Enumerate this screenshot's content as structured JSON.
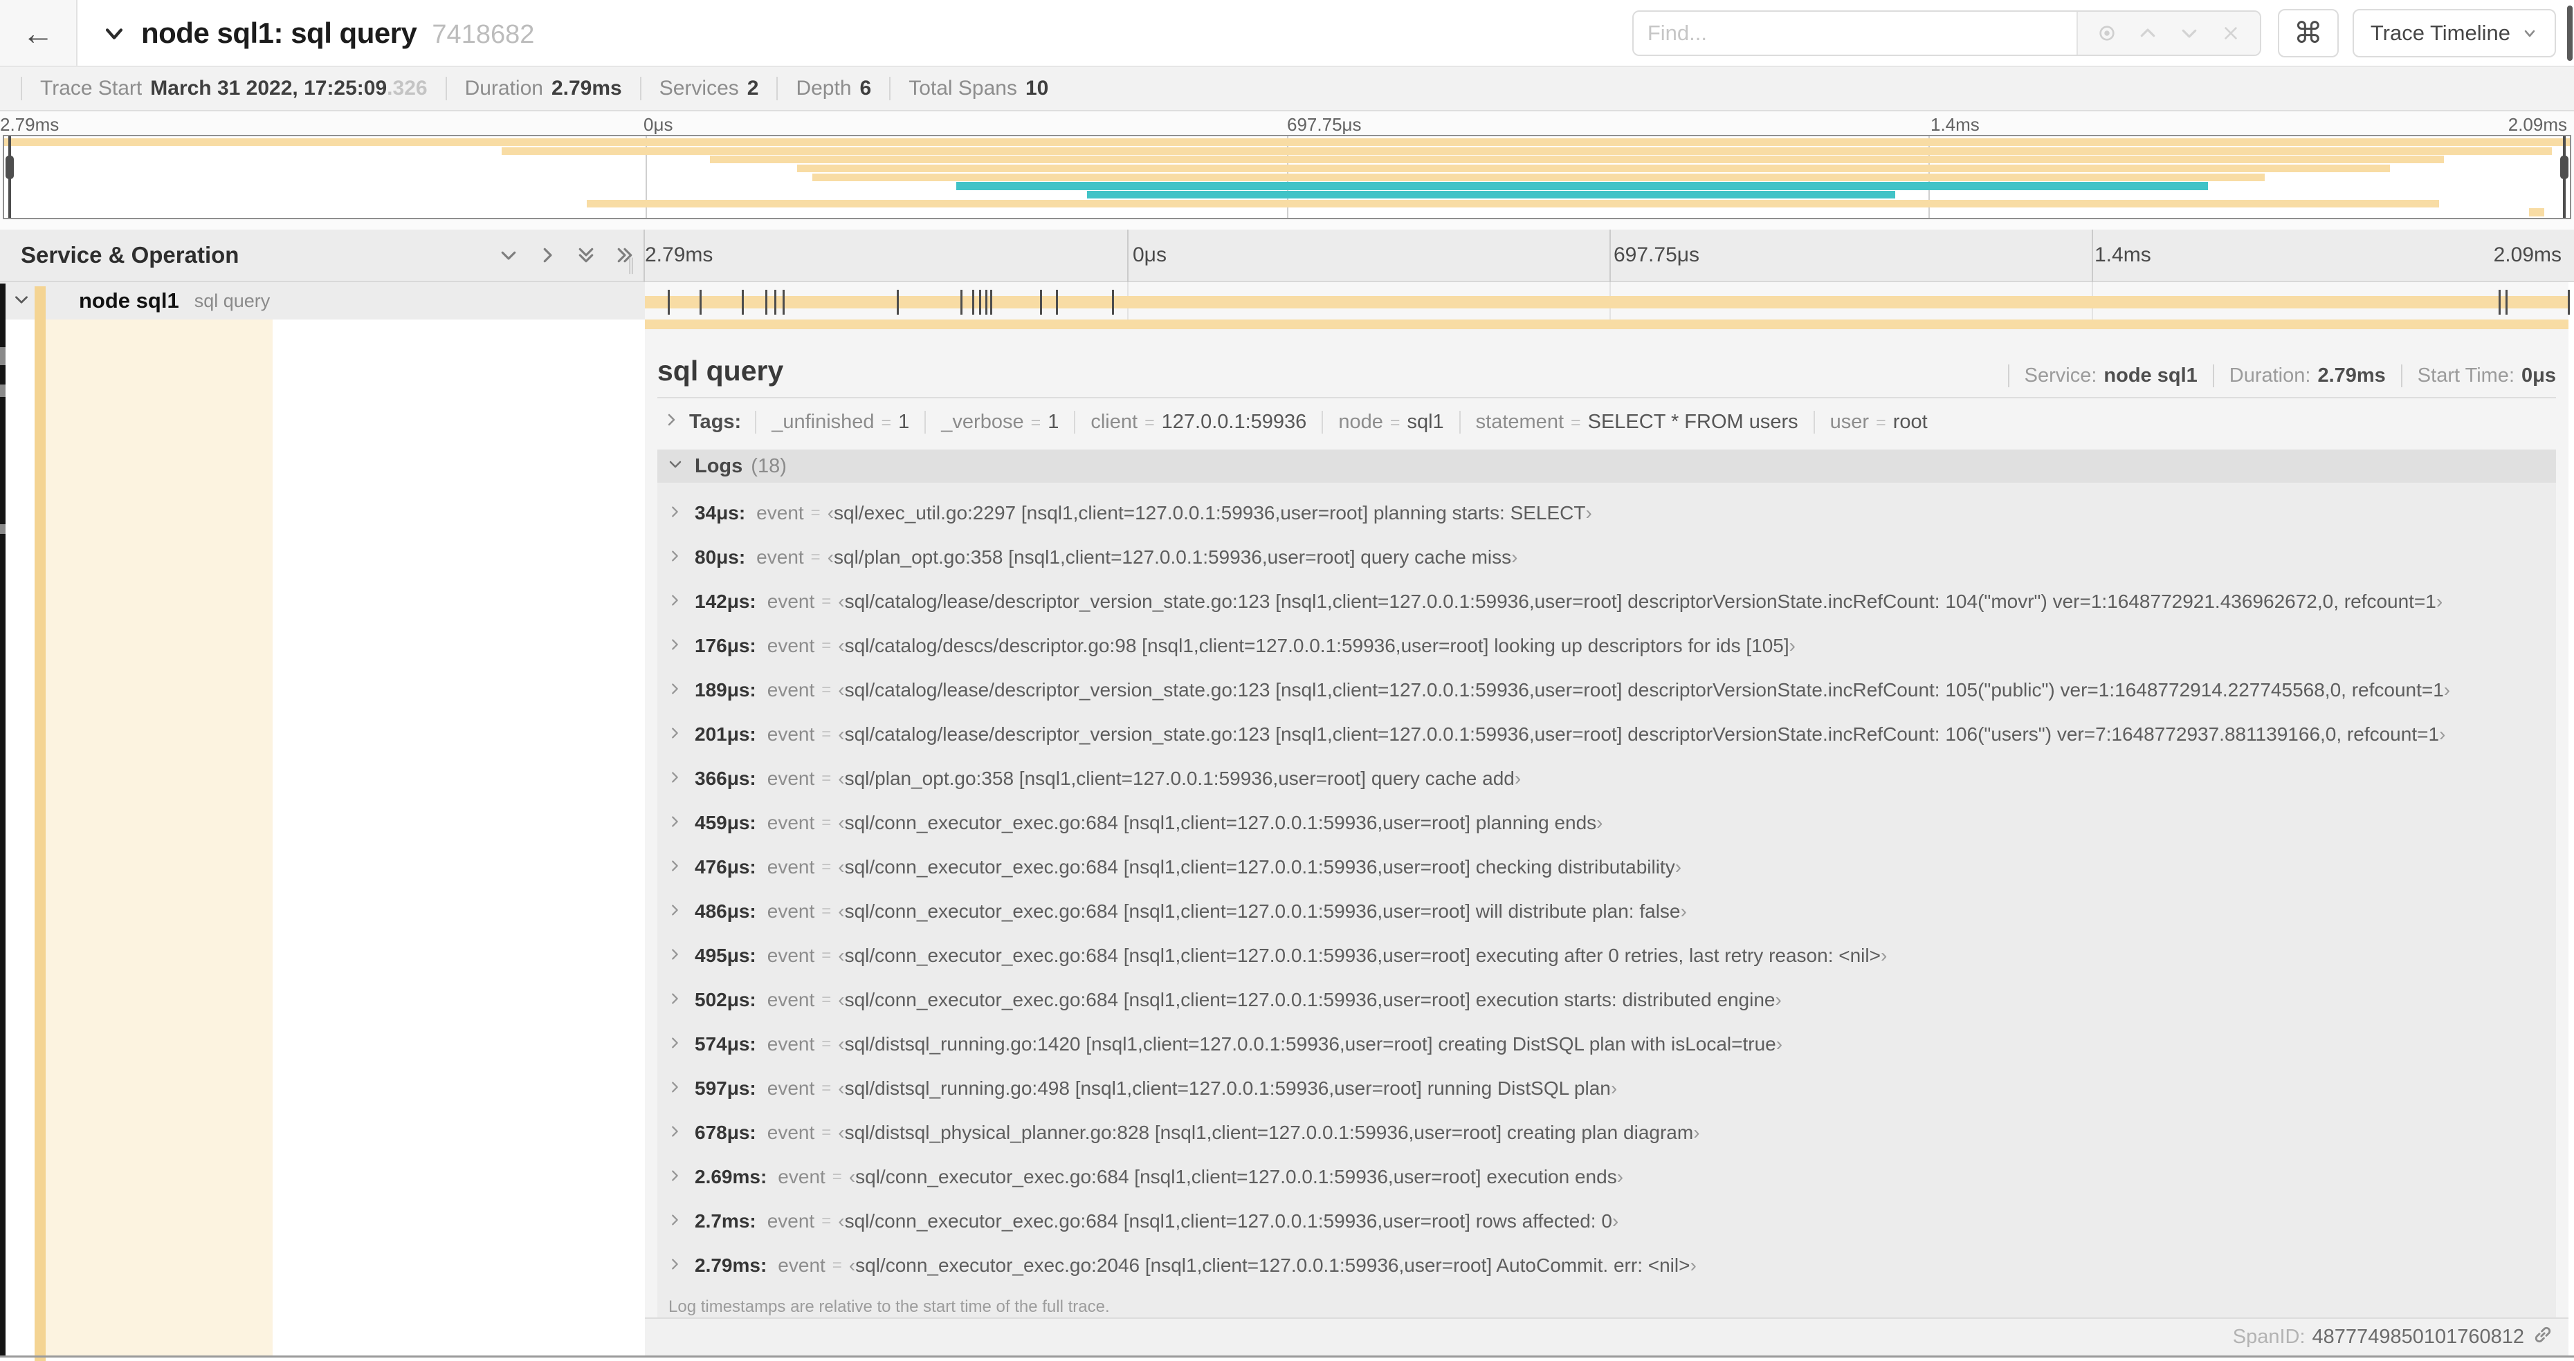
{
  "topbar": {
    "back_icon": "←",
    "title": "node sql1: sql query",
    "trace_id": "7418682",
    "find_placeholder": "Find...",
    "shortcut_button": "⌘",
    "view_selector": "Trace Timeline"
  },
  "infobar": {
    "items": [
      {
        "label": "Trace Start",
        "value": "March 31 2022, 17:25:09",
        "suffix": ".326"
      },
      {
        "label": "Duration",
        "value": "2.79ms",
        "suffix": ""
      },
      {
        "label": "Services",
        "value": "2",
        "suffix": ""
      },
      {
        "label": "Depth",
        "value": "6",
        "suffix": ""
      },
      {
        "label": "Total Spans",
        "value": "10",
        "suffix": ""
      }
    ]
  },
  "minimap": {
    "ticks": [
      "0μs",
      "697.75μs",
      "1.4ms",
      "2.09ms",
      "2.79ms"
    ],
    "spans": [
      {
        "start": 0.0,
        "end": 1.0,
        "color": "amber"
      },
      {
        "start": 0.194,
        "end": 0.993,
        "color": "amber"
      },
      {
        "start": 0.275,
        "end": 0.951,
        "color": "amber"
      },
      {
        "start": 0.309,
        "end": 0.93,
        "color": "amber"
      },
      {
        "start": 0.315,
        "end": 0.881,
        "color": "amber"
      },
      {
        "start": 0.371,
        "end": 0.859,
        "color": "teal"
      },
      {
        "start": 0.422,
        "end": 0.737,
        "color": "teal"
      },
      {
        "start": 0.227,
        "end": 0.949,
        "color": "amber"
      },
      {
        "start": 0.984,
        "end": 0.99,
        "color": "amber"
      }
    ]
  },
  "timeline": {
    "ticks": [
      "0μs",
      "697.75μs",
      "1.4ms",
      "2.09ms",
      "2.79ms"
    ],
    "total_label": "2.79ms"
  },
  "tree": {
    "header": "Service & Operation",
    "row": {
      "service": "node sql1",
      "operation": "sql query"
    }
  },
  "detail": {
    "title": "sql query",
    "meta": [
      {
        "label": "Service:",
        "value": "node sql1"
      },
      {
        "label": "Duration:",
        "value": "2.79ms"
      },
      {
        "label": "Start Time:",
        "value": "0μs"
      }
    ],
    "tags_label": "Tags:",
    "equals": "=",
    "quote_open": "‹",
    "quote_close": "›",
    "tags": [
      {
        "key": "_unfinished",
        "value": "1"
      },
      {
        "key": "_verbose",
        "value": "1"
      },
      {
        "key": "client",
        "value": "127.0.0.1:59936"
      },
      {
        "key": "node",
        "value": "sql1"
      },
      {
        "key": "statement",
        "value": "SELECT * FROM users"
      },
      {
        "key": "user",
        "value": "root"
      }
    ],
    "logs_label": "Logs",
    "logs_count": "(18)",
    "logs": [
      {
        "time": "34μs:",
        "key": "event",
        "value": "sql/exec_util.go:2297 [nsql1,client=127.0.0.1:59936,user=root] planning starts: SELECT"
      },
      {
        "time": "80μs:",
        "key": "event",
        "value": "sql/plan_opt.go:358 [nsql1,client=127.0.0.1:59936,user=root] query cache miss"
      },
      {
        "time": "142μs:",
        "key": "event",
        "value": "sql/catalog/lease/descriptor_version_state.go:123 [nsql1,client=127.0.0.1:59936,user=root] descriptorVersionState.incRefCount: 104(\"movr\") ver=1:1648772921.436962672,0, refcount=1"
      },
      {
        "time": "176μs:",
        "key": "event",
        "value": "sql/catalog/descs/descriptor.go:98 [nsql1,client=127.0.0.1:59936,user=root] looking up descriptors for ids [105]"
      },
      {
        "time": "189μs:",
        "key": "event",
        "value": "sql/catalog/lease/descriptor_version_state.go:123 [nsql1,client=127.0.0.1:59936,user=root] descriptorVersionState.incRefCount: 105(\"public\") ver=1:1648772914.227745568,0, refcount=1"
      },
      {
        "time": "201μs:",
        "key": "event",
        "value": "sql/catalog/lease/descriptor_version_state.go:123 [nsql1,client=127.0.0.1:59936,user=root] descriptorVersionState.incRefCount: 106(\"users\") ver=7:1648772937.881139166,0, refcount=1"
      },
      {
        "time": "366μs:",
        "key": "event",
        "value": "sql/plan_opt.go:358 [nsql1,client=127.0.0.1:59936,user=root] query cache add"
      },
      {
        "time": "459μs:",
        "key": "event",
        "value": "sql/conn_executor_exec.go:684 [nsql1,client=127.0.0.1:59936,user=root] planning ends"
      },
      {
        "time": "476μs:",
        "key": "event",
        "value": "sql/conn_executor_exec.go:684 [nsql1,client=127.0.0.1:59936,user=root] checking distributability"
      },
      {
        "time": "486μs:",
        "key": "event",
        "value": "sql/conn_executor_exec.go:684 [nsql1,client=127.0.0.1:59936,user=root] will distribute plan: false"
      },
      {
        "time": "495μs:",
        "key": "event",
        "value": "sql/conn_executor_exec.go:684 [nsql1,client=127.0.0.1:59936,user=root] executing after 0 retries, last retry reason: <nil>"
      },
      {
        "time": "502μs:",
        "key": "event",
        "value": "sql/conn_executor_exec.go:684 [nsql1,client=127.0.0.1:59936,user=root] execution starts: distributed engine"
      },
      {
        "time": "574μs:",
        "key": "event",
        "value": "sql/distsql_running.go:1420 [nsql1,client=127.0.0.1:59936,user=root] creating DistSQL plan with isLocal=true"
      },
      {
        "time": "597μs:",
        "key": "event",
        "value": "sql/distsql_running.go:498 [nsql1,client=127.0.0.1:59936,user=root] running DistSQL plan"
      },
      {
        "time": "678μs:",
        "key": "event",
        "value": "sql/distsql_physical_planner.go:828 [nsql1,client=127.0.0.1:59936,user=root] creating plan diagram"
      },
      {
        "time": "2.69ms:",
        "key": "event",
        "value": "sql/conn_executor_exec.go:684 [nsql1,client=127.0.0.1:59936,user=root] execution ends"
      },
      {
        "time": "2.7ms:",
        "key": "event",
        "value": "sql/conn_executor_exec.go:684 [nsql1,client=127.0.0.1:59936,user=root] rows affected: 0"
      },
      {
        "time": "2.79ms:",
        "key": "event",
        "value": "sql/conn_executor_exec.go:2046 [nsql1,client=127.0.0.1:59936,user=root] AutoCommit. err: <nil>"
      }
    ],
    "logs_note": "Log timestamps are relative to the start time of the full trace.",
    "span_id_label": "SpanID:",
    "span_id": "4877749850101760812"
  },
  "colors": {
    "amber": "#F8DCA4",
    "amber_strip": "#F4D493",
    "amber_faint": "#FCF3E0",
    "teal": "#41C3C7"
  }
}
